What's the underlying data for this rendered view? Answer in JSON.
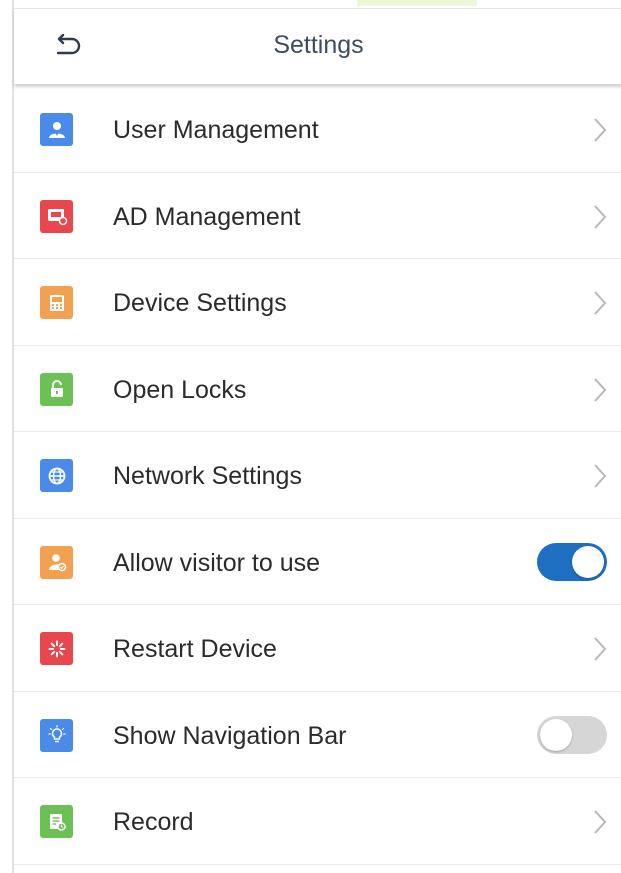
{
  "header": {
    "title": "Settings",
    "back_icon": "back-arrow-icon"
  },
  "colors": {
    "blue": "#4a8ae8",
    "red": "#e8474d",
    "orange": "#f2a151",
    "green": "#6cc156",
    "toggle_on": "#1e6fc1",
    "toggle_off": "#d6d6d6"
  },
  "menu": {
    "items": [
      {
        "label": "User Management",
        "icon": "user-icon",
        "color": "#4a8ae8",
        "control": "chevron"
      },
      {
        "label": "AD Management",
        "icon": "ad-icon",
        "color": "#e8474d",
        "control": "chevron"
      },
      {
        "label": "Device Settings",
        "icon": "device-icon",
        "color": "#f2a151",
        "control": "chevron"
      },
      {
        "label": "Open Locks",
        "icon": "unlock-icon",
        "color": "#6cc156",
        "control": "chevron"
      },
      {
        "label": "Network Settings",
        "icon": "globe-icon",
        "color": "#4a8ae8",
        "control": "chevron"
      },
      {
        "label": "Allow visitor to use",
        "icon": "visitor-icon",
        "color": "#f2a151",
        "control": "toggle",
        "toggle_on": true
      },
      {
        "label": "Restart Device",
        "icon": "restart-icon",
        "color": "#e8474d",
        "control": "chevron"
      },
      {
        "label": "Show Navigation Bar",
        "icon": "lightbulb-icon",
        "color": "#4a8ae8",
        "control": "toggle",
        "toggle_on": false
      },
      {
        "label": "Record",
        "icon": "record-icon",
        "color": "#6cc156",
        "control": "chevron"
      }
    ]
  }
}
